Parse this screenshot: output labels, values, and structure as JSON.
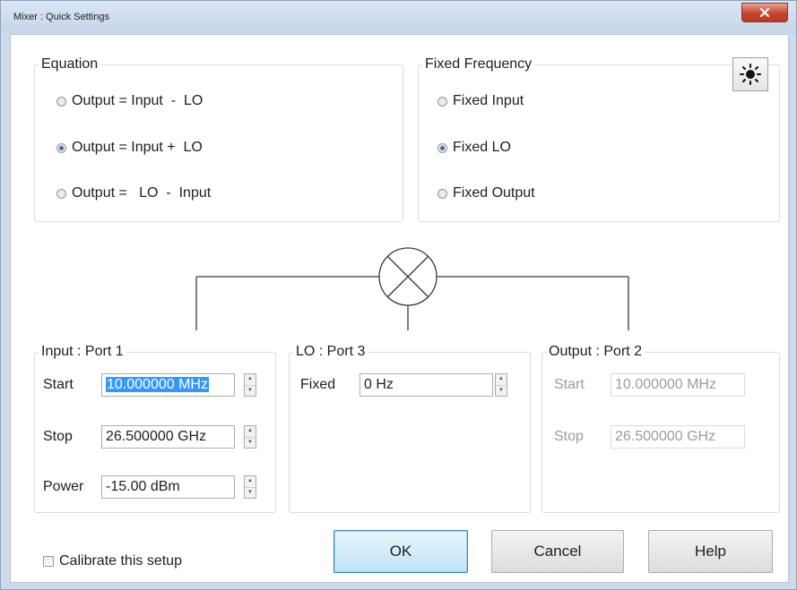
{
  "window": {
    "title": "Mixer : Quick Settings",
    "close_glyph": "x"
  },
  "equation": {
    "title": "Equation",
    "options": [
      {
        "label": "Output = Input  -  LO",
        "checked": false
      },
      {
        "label": "Output = Input +  LO",
        "checked": true
      },
      {
        "label": "Output =   LO  -  Input",
        "checked": false
      }
    ]
  },
  "fixed_frequency": {
    "title": "Fixed Frequency",
    "options": [
      {
        "label": "Fixed Input",
        "checked": false
      },
      {
        "label": "Fixed LO",
        "checked": true
      },
      {
        "label": "Fixed Output",
        "checked": false
      }
    ]
  },
  "display_button": {
    "icon": "sun-icon"
  },
  "mixer_symbol": {
    "icon": "mixer-cross-circle-icon"
  },
  "input_port": {
    "title": "Input : Port 1",
    "start_label": "Start",
    "start_value": "10.000000 MHz",
    "stop_label": "Stop",
    "stop_value": "26.500000 GHz",
    "power_label": "Power",
    "power_value": "-15.00 dBm"
  },
  "lo_port": {
    "title": "LO : Port 3",
    "fixed_label": "Fixed",
    "fixed_value": "0 Hz"
  },
  "output_port": {
    "title": "Output : Port 2",
    "start_label": "Start",
    "start_value": "10.000000 MHz",
    "stop_label": "Stop",
    "stop_value": "26.500000 GHz"
  },
  "calibrate": {
    "label": "Calibrate this setup",
    "checked": false
  },
  "buttons": {
    "ok": "OK",
    "cancel": "Cancel",
    "help": "Help"
  },
  "colors": {
    "accent_selection": "#3399ff",
    "close_button": "#c8432c",
    "default_button": "#3c7fb1"
  }
}
